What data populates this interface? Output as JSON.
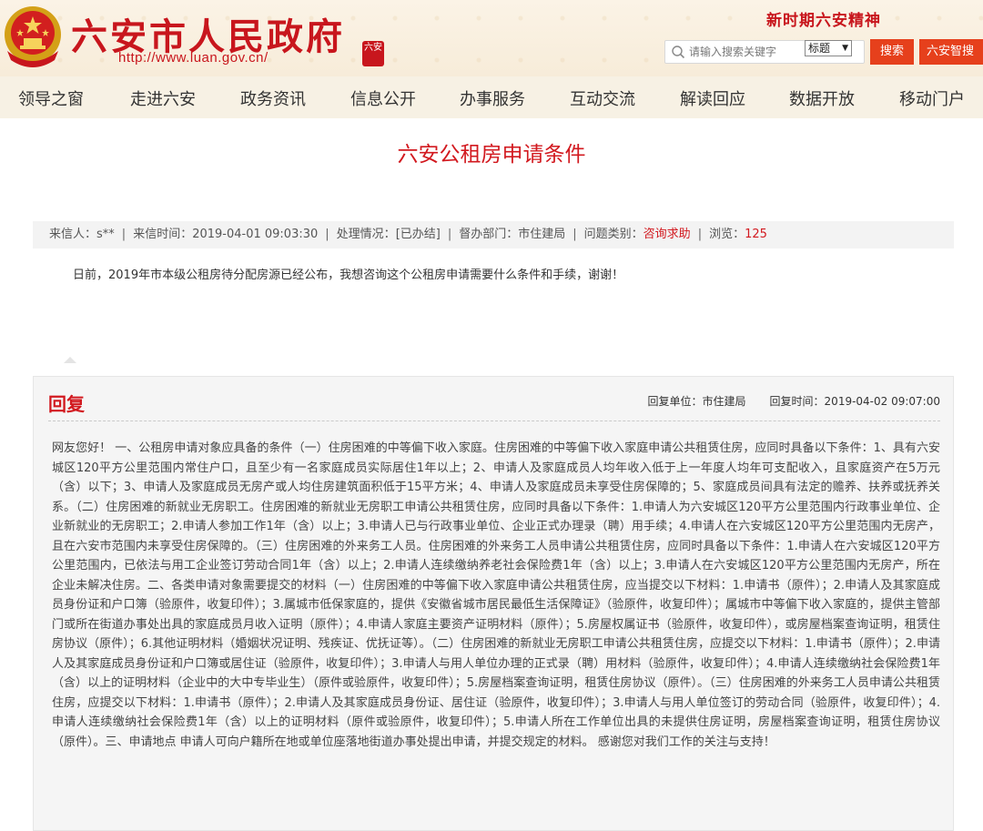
{
  "header": {
    "site_title": "六安市人民政府",
    "site_url": "http://www.luan.gov.cn/",
    "seal_text": "六安",
    "spirit_text": "新时期六安精神",
    "search_placeholder": "请输入搜索关键字",
    "search_scope": "标题",
    "search_button": "搜索",
    "zhisou_button": "六安智搜"
  },
  "nav": [
    "领导之窗",
    "走进六安",
    "政务资讯",
    "信息公开",
    "办事服务",
    "互动交流",
    "解读回应",
    "数据开放",
    "移动门户"
  ],
  "page_title": "六安公租房申请条件",
  "meta": {
    "sender_label": "来信人：",
    "sender": "s**",
    "time_label": "来信时间：",
    "time": "2019-04-01 09:03:30",
    "status_label": "处理情况：",
    "status": "[已办结]",
    "dept_label": "督办部门：",
    "dept": "市住建局",
    "category_label": "问题类别：",
    "category": "咨询求助",
    "views_label": "浏览：",
    "views": "125"
  },
  "question": "日前，2019年市本级公租房待分配房源已经公布，我想咨询这个公租房申请需要什么条件和手续，谢谢！",
  "reply": {
    "title": "回复",
    "unit_label": "回复单位：",
    "unit": "市住建局",
    "time_label": "回复时间：",
    "time": "2019-04-02 09:07:00",
    "body": "网友您好！ 一、公租房申请对象应具备的条件（一）住房困难的中等偏下收入家庭。住房困难的中等偏下收入家庭申请公共租赁住房，应同时具备以下条件：1、具有六安城区120平方公里范围内常住户口，且至少有一名家庭成员实际居住1年以上；2、申请人及家庭成员人均年收入低于上一年度人均年可支配收入，且家庭资产在5万元（含）以下；3、申请人及家庭成员无房产或人均住房建筑面积低于15平方米；4、申请人及家庭成员未享受住房保障的；5、家庭成员间具有法定的赡养、扶养或抚养关系。（二）住房困难的新就业无房职工。住房困难的新就业无房职工申请公共租赁住房，应同时具备以下条件：1.申请人为六安城区120平方公里范围内行政事业单位、企业新就业的无房职工；2.申请人参加工作1年（含）以上；3.申请人已与行政事业单位、企业正式办理录（聘）用手续；4.申请人在六安城区120平方公里范围内无房产，且在六安市范围内未享受住房保障的。（三）住房困难的外来务工人员。住房困难的外来务工人员申请公共租赁住房，应同时具备以下条件：1.申请人在六安城区120平方公里范围内，已依法与用工企业签订劳动合同1年（含）以上；2.申请人连续缴纳养老社会保险费1年（含）以上；3.申请人在六安城区120平方公里范围内无房产，所在企业未解决住房。二、各类申请对象需要提交的材料（一）住房困难的中等偏下收入家庭申请公共租赁住房，应当提交以下材料：1.申请书（原件）；2.申请人及其家庭成员身份证和户口簿（验原件，收复印件）；3.属城市低保家庭的，提供《安徽省城市居民最低生活保障证》（验原件，收复印件）；属城市中等偏下收入家庭的，提供主管部门或所在街道办事处出具的家庭成员月收入证明（原件）；4.申请人家庭主要资产证明材料（原件）；5.房屋权属证书（验原件，收复印件），或房屋档案查询证明，租赁住房协议（原件）；6.其他证明材料（婚姻状况证明、残疾证、优抚证等）。（二）住房困难的新就业无房职工申请公共租赁住房，应提交以下材料：1.申请书（原件）；2.申请人及其家庭成员身份证和户口簿或居住证（验原件，收复印件）；3.申请人与用人单位办理的正式录（聘）用材料（验原件，收复印件）；4.申请人连续缴纳社会保险费1年（含）以上的证明材料（企业中的大中专毕业生）（原件或验原件，收复印件）；5.房屋档案查询证明，租赁住房协议（原件）。（三）住房困难的外来务工人员申请公共租赁住房，应提交以下材料：1.申请书（原件）；2.申请人及其家庭成员身份证、居住证（验原件，收复印件）；3.申请人与用人单位签订的劳动合同（验原件，收复印件）；4.申请人连续缴纳社会保险费1年（含）以上的证明材料（原件或验原件，收复印件）；5.申请人所在工作单位出具的未提供住房证明，房屋档案查询证明，租赁住房协议（原件）。三、申请地点 申请人可向户籍所在地或单位座落地街道办事处提出申请，并提交规定的材料。 感谢您对我们工作的关注与支持！"
  }
}
